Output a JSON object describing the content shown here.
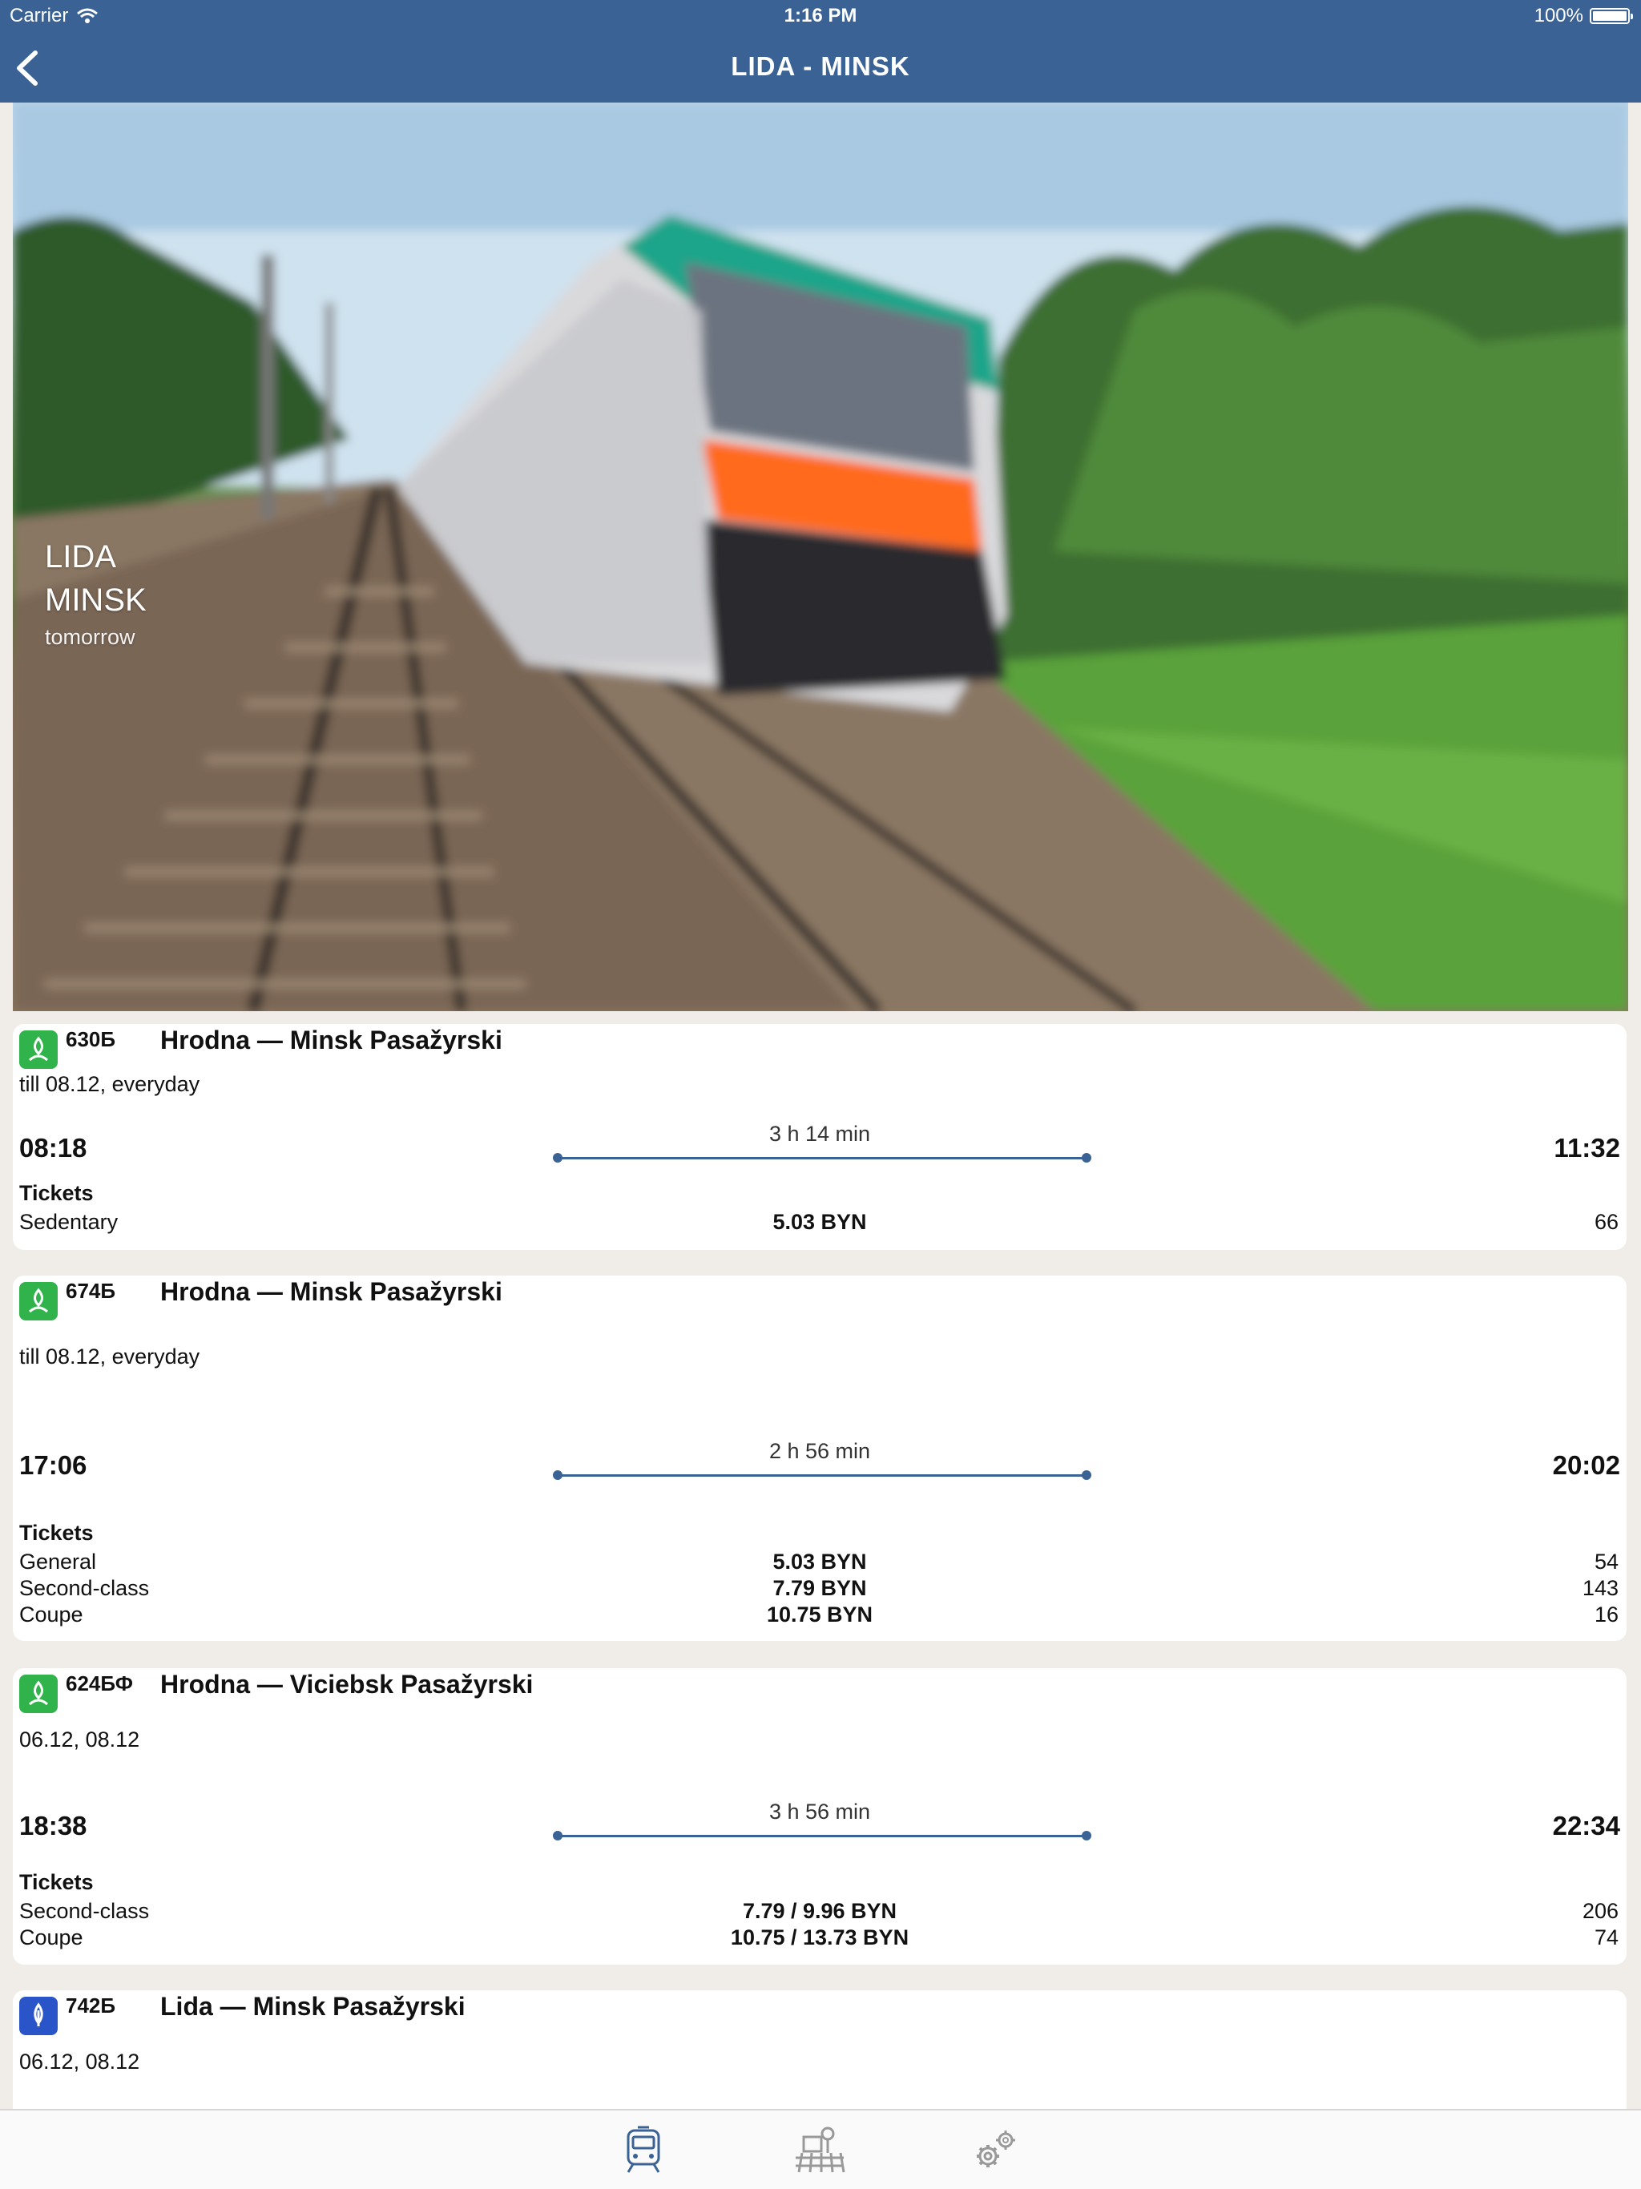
{
  "status_bar": {
    "carrier": "Carrier",
    "time": "1:16 PM",
    "battery": "100%"
  },
  "nav": {
    "title": "LIDA - MINSK"
  },
  "hero": {
    "from": "LIDA",
    "to": "MINSK",
    "when": "tomorrow"
  },
  "trains": [
    {
      "number": "630Б",
      "type_icon": "regional-green-icon",
      "route": "Hrodna — Minsk Pasažyrski",
      "schedule": "till 08.12, everyday",
      "departure": "08:18",
      "arrival": "11:32",
      "duration": "3 h 14 min",
      "tickets_label": "Tickets",
      "fares": [
        {
          "class": "Sedentary",
          "price": "5.03 BYN",
          "seats": "66"
        }
      ]
    },
    {
      "number": "674Б",
      "type_icon": "regional-green-icon",
      "route": "Hrodna — Minsk Pasažyrski",
      "schedule": "till 08.12, everyday",
      "departure": "17:06",
      "arrival": "20:02",
      "duration": "2 h 56 min",
      "tickets_label": "Tickets",
      "fares": [
        {
          "class": "General",
          "price": "5.03 BYN",
          "seats": "54"
        },
        {
          "class": "Second-class",
          "price": "7.79 BYN",
          "seats": "143"
        },
        {
          "class": "Coupe",
          "price": "10.75 BYN",
          "seats": "16"
        }
      ]
    },
    {
      "number": "624БФ",
      "type_icon": "regional-green-icon",
      "route": "Hrodna — Viciebsk Pasažyrski",
      "schedule": "06.12, 08.12",
      "departure": "18:38",
      "arrival": "22:34",
      "duration": "3 h 56 min",
      "tickets_label": "Tickets",
      "fares": [
        {
          "class": "Second-class",
          "price": "7.79 / 9.96 BYN",
          "seats": "206"
        },
        {
          "class": "Coupe",
          "price": "10.75 / 13.73 BYN",
          "seats": "74"
        }
      ]
    },
    {
      "number": "742Б",
      "type_icon": "interregional-blue-icon",
      "route": "Lida — Minsk Pasažyrski",
      "schedule": "06.12, 08.12"
    }
  ],
  "tabbar": {
    "tabs": [
      {
        "name": "trains",
        "icon": "train-front-icon",
        "active": true
      },
      {
        "name": "stations",
        "icon": "station-rails-icon",
        "active": false
      },
      {
        "name": "settings",
        "icon": "gears-icon",
        "active": false
      }
    ]
  },
  "colors": {
    "nav": "#3b6294",
    "regional_badge": "#2fb34a",
    "interregional_badge": "#2a55c8",
    "background": "#f0ede8"
  }
}
